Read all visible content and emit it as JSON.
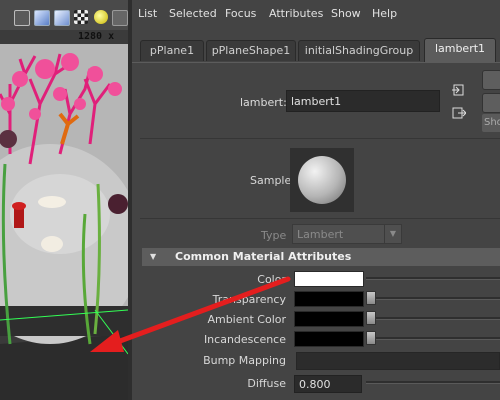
{
  "viewport": {
    "resolution": "1280 x",
    "toolbar_icons": [
      "wireframe-icon",
      "smooth-shade-icon",
      "textured-icon",
      "checker-icon",
      "lights-icon",
      "more-icon"
    ]
  },
  "menu": {
    "items": [
      "List",
      "Selected",
      "Focus",
      "Attributes",
      "Show",
      "Help"
    ]
  },
  "tabs": [
    "pPlane1",
    "pPlaneShape1",
    "initialShadingGroup",
    "lambert1"
  ],
  "active_tab_index": 3,
  "node": {
    "label": "lambert:",
    "value": "lambert1"
  },
  "sample": {
    "label": "Sample"
  },
  "type_field": {
    "label": "Type",
    "value": "Lambert"
  },
  "section": {
    "title": "Common Material Attributes"
  },
  "attributes": {
    "color": {
      "label": "Color",
      "swatch": "#ffffff"
    },
    "transparency": {
      "label": "Transparency",
      "swatch": "#000000",
      "slider": 0.0
    },
    "ambient": {
      "label": "Ambient Color",
      "swatch": "#000000",
      "slider": 0.0
    },
    "incandescence": {
      "label": "Incandescence",
      "swatch": "#000000",
      "slider": 0.0
    },
    "bump": {
      "label": "Bump Mapping"
    },
    "diffuse": {
      "label": "Diffuse",
      "value": "0.800"
    }
  },
  "side_buttons": {
    "show_label": "Sho"
  },
  "colors": {
    "annotation_arrow": "#e41e1e",
    "panel_bg": "#444444",
    "section_bg": "#5d5d5d"
  }
}
